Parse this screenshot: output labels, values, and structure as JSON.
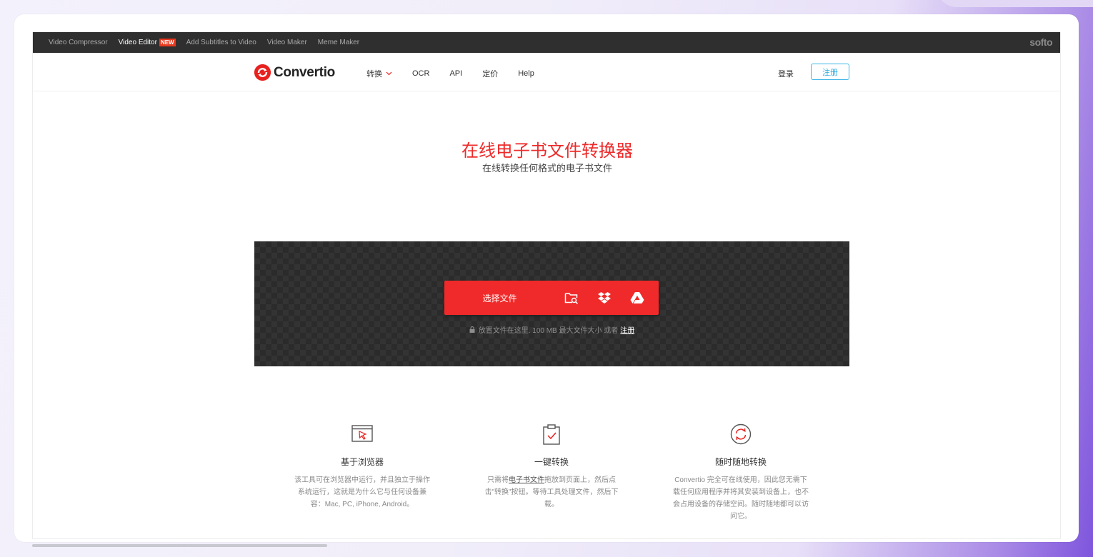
{
  "topbar": {
    "links": [
      {
        "label": "Video Compressor",
        "active": false
      },
      {
        "label": "Video Editor",
        "active": true,
        "badge": "NEW"
      },
      {
        "label": "Add Subtitles to Video",
        "active": false
      },
      {
        "label": "Video Maker",
        "active": false
      },
      {
        "label": "Meme Maker",
        "active": false
      }
    ],
    "brand": "softo"
  },
  "nav": {
    "logo_text": "Convertio",
    "links": [
      "转换",
      "OCR",
      "API",
      "定价",
      "Help"
    ],
    "login": "登录",
    "signup": "注册"
  },
  "hero": {
    "title": "在线电子书文件转换器",
    "subtitle": "在线转换任何格式的电子书文件"
  },
  "upload": {
    "choose_label": "选择文件",
    "icons": [
      "folder-search-icon",
      "dropbox-icon",
      "google-drive-icon"
    ],
    "drop_note": "放置文件在这里. 100 MB 最大文件大小 或者",
    "drop_note_link": "注册"
  },
  "features": [
    {
      "icon": "browser-cursor-icon",
      "title": "基于浏览器",
      "desc": "该工具可在浏览器中运行，并且独立于操作系统运行，这就是为什么它与任何设备兼容：Mac, PC, iPhone, Android。"
    },
    {
      "icon": "clipboard-check-icon",
      "title": "一键转换",
      "desc_pre": "只需将",
      "desc_link": "电子书文件",
      "desc_post": "拖放到页面上，然后点击\"转换\"按钮。等待工具处理文件，然后下载。"
    },
    {
      "icon": "refresh-circle-icon",
      "title": "随时随地转换",
      "desc": "Convertio 完全可在线使用，因此您无需下载任何应用程序并将其安装到设备上，也不会占用设备的存储空间。随时随地都可以访问它。"
    }
  ],
  "colors": {
    "brand_red": "#f02a2a",
    "signup_blue": "#2aa9dd",
    "topbar_bg": "#2f2f2f"
  }
}
